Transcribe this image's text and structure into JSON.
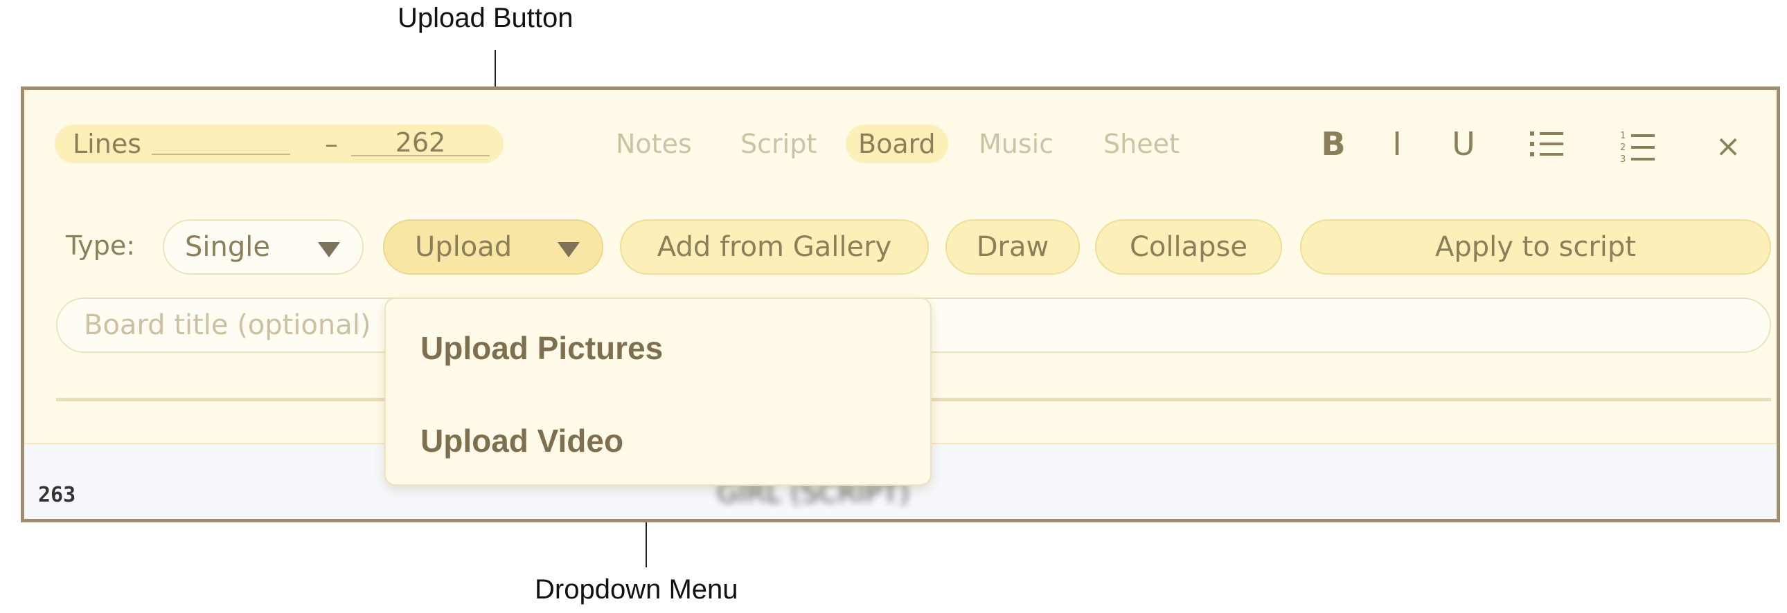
{
  "annotations": {
    "upload_button": "Upload Button",
    "dropdown_menu": "Dropdown Menu"
  },
  "header": {
    "lines_label": "Lines",
    "lines_start": "",
    "lines_separator": "–",
    "lines_end": "262"
  },
  "tabs": [
    {
      "label": "Notes",
      "active": false
    },
    {
      "label": "Script",
      "active": false
    },
    {
      "label": "Board",
      "active": true
    },
    {
      "label": "Music",
      "active": false
    },
    {
      "label": "Sheet",
      "active": false
    }
  ],
  "format_toolbar": {
    "bold": "B",
    "italic": "I",
    "underline": "U",
    "bullet_list_icon": "bullet-list-icon",
    "numbered_list_icon": "numbered-list-icon",
    "close": "×"
  },
  "toolbar": {
    "type_label": "Type:",
    "type_value": "Single",
    "upload_label": "Upload",
    "add_from_gallery_label": "Add from Gallery",
    "draw_label": "Draw",
    "collapse_label": "Collapse",
    "apply_label": "Apply to script"
  },
  "board_title": {
    "placeholder": "Board title (optional)",
    "value": ""
  },
  "dropdown": {
    "items": [
      {
        "label": "Upload Pictures"
      },
      {
        "label": "Upload Video"
      }
    ]
  },
  "script_line": {
    "number": "263",
    "text": "GIRL (SCRIPT)"
  },
  "colors": {
    "panel_bg": "#fffbe8",
    "pill_bg": "#fcefb7",
    "text": "#8b7f5a",
    "frame_border": "#a08c6e"
  }
}
